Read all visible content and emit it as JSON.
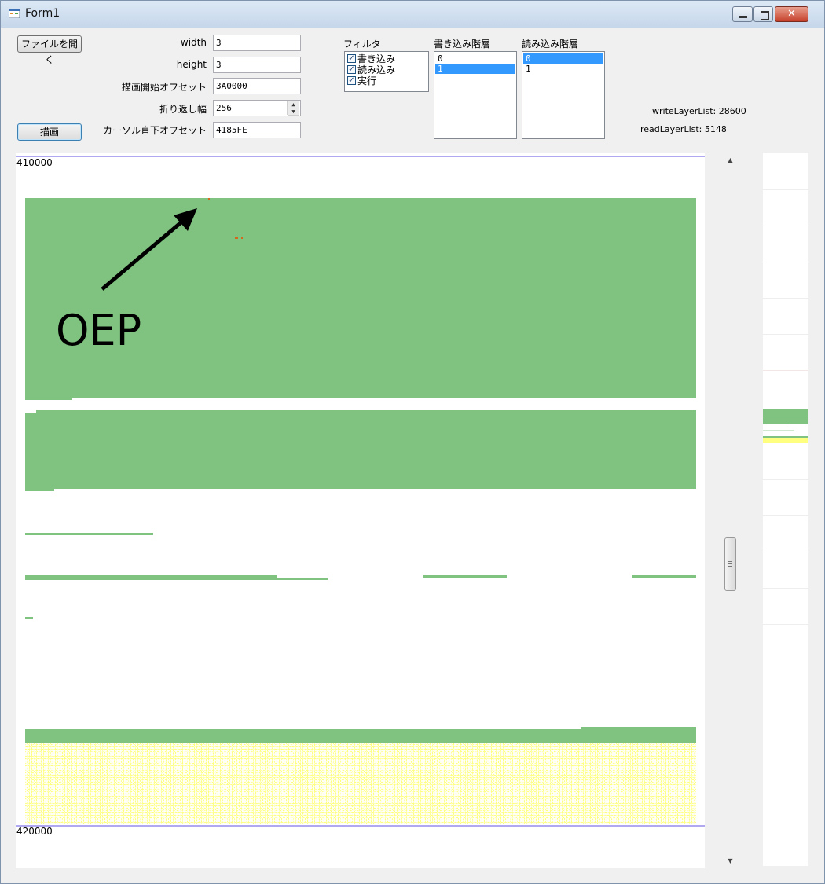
{
  "window": {
    "title": "Form1"
  },
  "controls": {
    "open_file_button": "ファイルを開く",
    "draw_button": "描画",
    "fields": [
      {
        "label": "width",
        "value": "3"
      },
      {
        "label": "height",
        "value": "3"
      },
      {
        "label": "描画開始オフセット",
        "value": "3A0000"
      },
      {
        "label": "折り返し幅",
        "value": "256"
      },
      {
        "label": "カーソル直下オフセット",
        "value": "4185FE"
      }
    ],
    "filter": {
      "label": "フィルタ",
      "items": [
        {
          "label": "書き込み",
          "checked": true
        },
        {
          "label": "読み込み",
          "checked": true
        },
        {
          "label": "実行",
          "checked": true
        }
      ]
    },
    "write_layer": {
      "label": "書き込み階層",
      "items": [
        "0",
        "1"
      ],
      "selected": "1"
    },
    "read_layer": {
      "label": "読み込み階層",
      "items": [
        "0",
        "1"
      ],
      "selected": "0"
    },
    "stats": {
      "write_layer_list": "writeLayerList: 28600",
      "read_layer_list": "readLayerList: 5148"
    }
  },
  "canvas": {
    "offset_top": "410000",
    "offset_bottom": "420000",
    "annotation": "OEP",
    "colors": {
      "write": "#80c280",
      "read": "#ffff80",
      "exec": "#d2691e",
      "offset_line": "#b0a8f0"
    }
  }
}
